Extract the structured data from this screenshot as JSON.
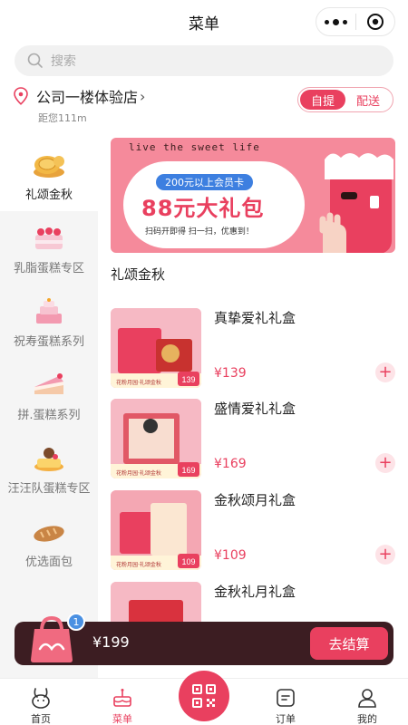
{
  "header": {
    "title": "菜单"
  },
  "search": {
    "placeholder": "搜索"
  },
  "store": {
    "name": "公司一楼体验店",
    "arrow": "›",
    "distance": "距您111m"
  },
  "delivery_toggle": {
    "options": [
      "自提",
      "配送"
    ],
    "selected": "自提"
  },
  "sidebar": {
    "items": [
      {
        "label": "礼颂金秋",
        "icon": "mooncake-icon",
        "active": true
      },
      {
        "label": "乳脂蛋糕专区",
        "icon": "strawberry-cake-icon",
        "active": false
      },
      {
        "label": "祝寿蛋糕系列",
        "icon": "birthday-cake-icon",
        "active": false
      },
      {
        "label": "拼.蛋糕系列",
        "icon": "cake-slice-icon",
        "active": false
      },
      {
        "label": "汪汪队蛋糕专区",
        "icon": "character-cake-icon",
        "active": false
      },
      {
        "label": "优选面包",
        "icon": "bread-icon",
        "active": false
      }
    ]
  },
  "banner": {
    "tagline": "live the sweet life",
    "pill": "200元以上会员卡",
    "headline": "88元大礼包",
    "subtext": "扫码开即得 扫一扫，优惠到！"
  },
  "section": {
    "title": "礼颂金秋"
  },
  "products": [
    {
      "name": "真挚爱礼礼盒",
      "price": "¥139",
      "thumb_price": "139",
      "thumb_caption": "花粉月园·礼颂金秋"
    },
    {
      "name": "盛情爱礼礼盒",
      "price": "¥169",
      "thumb_price": "169",
      "thumb_caption": "花粉月园·礼颂金秋"
    },
    {
      "name": "金秋颂月礼盒",
      "price": "¥109",
      "thumb_price": "109",
      "thumb_caption": "花粉月园·礼颂金秋"
    },
    {
      "name": "金秋礼月礼盒",
      "price": "",
      "thumb_price": "",
      "thumb_caption": ""
    }
  ],
  "cart": {
    "count": "1",
    "total": "¥199",
    "checkout_label": "去结算"
  },
  "tabs": [
    {
      "label": "首页",
      "icon": "rabbit-home-icon",
      "active": false
    },
    {
      "label": "菜单",
      "icon": "cake-menu-icon",
      "active": true
    },
    {
      "label": "",
      "icon": "qr-scan-icon",
      "active": false
    },
    {
      "label": "订单",
      "icon": "order-icon",
      "active": false
    },
    {
      "label": "我的",
      "icon": "user-icon",
      "active": false
    }
  ],
  "colors": {
    "accent": "#e9405f",
    "cart_bar": "#3c1d22",
    "banner_bg": "#f58a9b",
    "badge": "#4a90e2"
  }
}
